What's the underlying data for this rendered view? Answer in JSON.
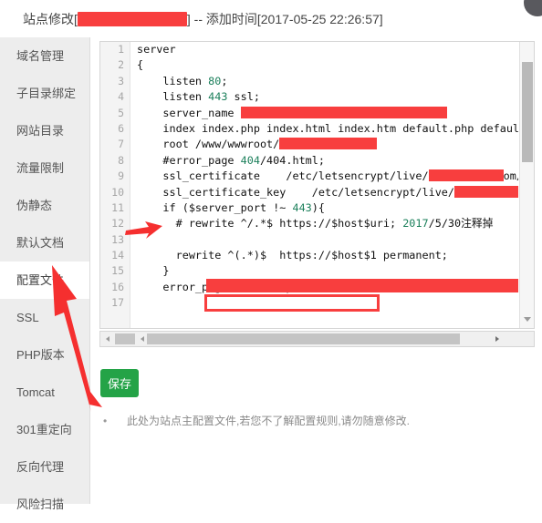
{
  "header": {
    "title_prefix": "站点修改[",
    "redacted": "",
    "title_suffix": "] -- 添加时间[2017-05-25 22:26:57]",
    "corner_icon": "circle-avatar"
  },
  "sidebar": {
    "items": [
      {
        "label": "域名管理",
        "active": false
      },
      {
        "label": "子目录绑定",
        "active": false
      },
      {
        "label": "网站目录",
        "active": false
      },
      {
        "label": "流量限制",
        "active": false
      },
      {
        "label": "伪静态",
        "active": false
      },
      {
        "label": "默认文档",
        "active": false
      },
      {
        "label": "配置文件",
        "active": true
      },
      {
        "label": "SSL",
        "active": false
      },
      {
        "label": "PHP版本",
        "active": false
      },
      {
        "label": "Tomcat",
        "active": false
      },
      {
        "label": "301重定向",
        "active": false
      },
      {
        "label": "反向代理",
        "active": false
      },
      {
        "label": "风险扫描",
        "active": false
      }
    ]
  },
  "editor": {
    "line_numbers": [
      "1",
      "2",
      "3",
      "4",
      "5",
      "6",
      "7",
      "8",
      "9",
      "10",
      "11",
      "12",
      "13",
      "14",
      "15",
      "16",
      "17"
    ],
    "lines": [
      "server",
      "{",
      "    listen 80;",
      "    listen 443 ssl;",
      "    server_name ",
      "    index index.php index.html index.htm default.php default.htm defaul",
      "    root /www/wwwroot/",
      "    #error_page 404/404.html;",
      "    ssl_certificate    /etc/letsencrypt/live/",
      "    ssl_certificate_key    /etc/letsencrypt/live/",
      "    if ($server_port !~ 443){",
      "      # rewrite ^/.*$ https://$host$uri; 2017/5/30注释掉",
      "",
      "      rewrite ^(.*)$  https://$host$1 permanent;",
      "    }",
      "    error_page 497  https://$host$uri;",
      ""
    ],
    "highlighted_rule": "rewrite ^(.*)$  https://$host$1 permanent;",
    "comment_note": "2017/5/30注释掉",
    "scroll_up_icon": "triangle-up-icon",
    "scroll_down_icon": "triangle-down-icon",
    "scroll_left_icon": "triangle-left-icon",
    "scroll_right_icon": "triangle-right-icon"
  },
  "actions": {
    "save_label": "保存"
  },
  "note": {
    "bullet": "•",
    "text": "此处为站点主配置文件,若您不了解配置规则,请勿随意修改."
  },
  "colors": {
    "accent_green": "#24a347",
    "redact_red": "#f83e3e",
    "sidebar_bg": "#ededed",
    "number_green": "#1a7f5a"
  }
}
